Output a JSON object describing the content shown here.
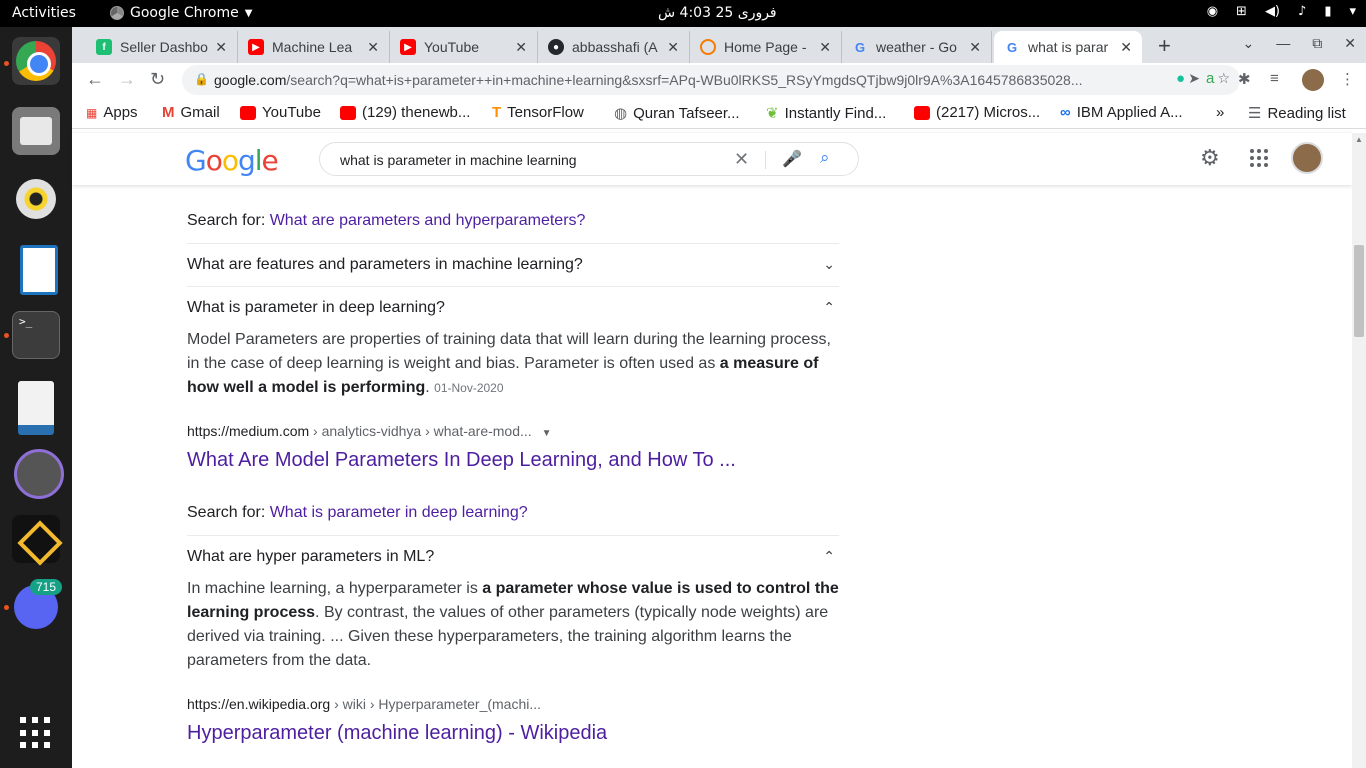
{
  "topbar": {
    "activities": "Activities",
    "app": "Google Chrome",
    "clock": "فروری 25  4:03 ش"
  },
  "dock": {
    "discord_badge": "715"
  },
  "tabs": [
    {
      "title": "Seller Dashbo",
      "favicon": "fiverr-icon",
      "color": "#1dbf73"
    },
    {
      "title": "Machine Lea",
      "favicon": "youtube-icon",
      "color": "#ff0000"
    },
    {
      "title": "YouTube",
      "favicon": "youtube-icon",
      "color": "#ff0000"
    },
    {
      "title": "abbasshafi (A",
      "favicon": "github-icon",
      "color": "#24292e"
    },
    {
      "title": "Home Page -",
      "favicon": "loading-icon",
      "color": "#f57c00"
    },
    {
      "title": "weather - Go",
      "favicon": "google-icon",
      "color": "#4285f4"
    },
    {
      "title": "what is parar",
      "favicon": "google-icon",
      "color": "#4285f4"
    }
  ],
  "toolbar": {
    "url_host": "google.com",
    "url_path": "/search?q=what+is+parameter++in+machine+learning&sxsrf=APq-WBu0lRKS5_RSyYmgdsQTjbw9j0lr9A%3A1645786835028..."
  },
  "bookmarks": [
    {
      "label": "Apps",
      "icon": "apps-grid-icon",
      "color": "#ea4335"
    },
    {
      "label": "Gmail",
      "icon": "gmail-icon",
      "color": "#ea4335"
    },
    {
      "label": "YouTube",
      "icon": "youtube-icon",
      "color": "#ff0000"
    },
    {
      "label": "(129) thenewb...",
      "icon": "youtube-icon",
      "color": "#ff0000"
    },
    {
      "label": "TensorFlow",
      "icon": "tensorflow-icon",
      "color": "#ff8f00"
    },
    {
      "label": "Quran Tafseer...",
      "icon": "globe-icon",
      "color": "#5f6368"
    },
    {
      "label": "Instantly Find...",
      "icon": "leaf-icon",
      "color": "#6fbf3b"
    },
    {
      "label": "(2217) Micros...",
      "icon": "youtube-icon",
      "color": "#ff0000"
    },
    {
      "label": "IBM Applied A...",
      "icon": "link-icon",
      "color": "#1a73e8"
    }
  ],
  "reading_list": "Reading list",
  "search": {
    "query": "what is parameter  in machine learning"
  },
  "results": {
    "searchfor1_prefix": "Search for: ",
    "searchfor1_link": "What are parameters and hyperparameters?",
    "q1": "What are features and parameters in machine learning?",
    "q2": "What is parameter in deep learning?",
    "a2_part1": "Model Parameters are properties of training data that will learn during the learning process, in the case of deep learning is weight and bias. Parameter is often used as ",
    "a2_bold": "a measure of how well a model is performing",
    "a2_part2": ". ",
    "a2_date": "01-Nov-2020",
    "cite1_host": "https://medium.com",
    "cite1_path": " › analytics-vidhya › what-are-mod...",
    "title1": "What Are Model Parameters In Deep Learning, and How To ...",
    "searchfor2_prefix": "Search for: ",
    "searchfor2_link": "What is parameter in deep learning?",
    "q3": "What are hyper parameters in ML?",
    "a3_part1": "In machine learning, a hyperparameter is ",
    "a3_bold": "a parameter whose value is used to control the learning process",
    "a3_part2": ". By contrast, the values of other parameters (typically node weights) are derived via training. ... Given these hyperparameters, the training algorithm learns the parameters from the data.",
    "cite2_host": "https://en.wikipedia.org",
    "cite2_path": " › wiki › Hyperparameter_(machi...",
    "title2": "Hyperparameter (machine learning) - Wikipedia"
  }
}
